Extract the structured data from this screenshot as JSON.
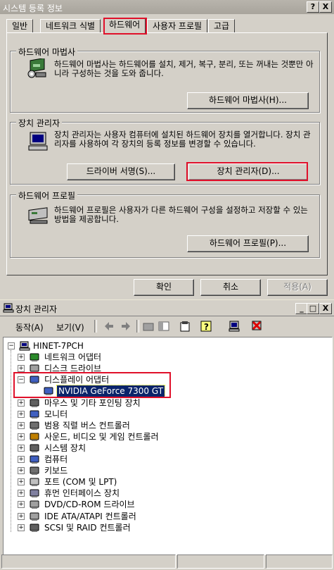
{
  "sysdlg": {
    "title": "시스템 등록 정보",
    "help_btn": "?",
    "close_btn": "X",
    "tabs": [
      "일반",
      "네트워크 식별",
      "하드웨어",
      "사용자 프로필",
      "고급"
    ],
    "groups": {
      "wizard": {
        "label": "하드웨어 마법사",
        "text": "하드웨어 마법사는 하드웨어를 설치, 제거, 복구, 분리, 또는 꺼내는 것뿐만 아니라 구성하는 것을 도와 줍니다.",
        "button": "하드웨어 마법사(H)..."
      },
      "devmgr": {
        "label": "장치 관리자",
        "text": "장치 관리자는 사용자 컴퓨터에 설치된 하드웨어 장치를 열거합니다. 장치 관리자를 사용하여 각 장치의 등록 정보를 변경할 수 있습니다.",
        "btn_sign": "드라이버 서명(S)...",
        "btn_devmgr": "장치 관리자(D)..."
      },
      "profile": {
        "label": "하드웨어 프로필",
        "text": "하드웨어 프로필은 사용자가 다른 하드웨어 구성을 설정하고 저장할 수 있는 방법을 제공합니다.",
        "button": "하드웨어 프로필(P)..."
      }
    },
    "buttons": {
      "ok": "확인",
      "cancel": "취소",
      "apply": "적용(A)"
    }
  },
  "devmgr": {
    "title": "장치 관리자",
    "min": "_",
    "max": "□",
    "close": "X",
    "menu": [
      "동작(A)",
      "보기(V)"
    ],
    "tree": {
      "root": "HINET-7PCH",
      "items": [
        "네트워크 어댑터",
        "디스크 드라이브",
        "디스플레이 어댑터",
        "NVIDIA GeForce 7300 GT",
        "마우스 및 기타 포인팅 장치",
        "모니터",
        "범용 직렬 버스 컨트롤러",
        "사운드, 비디오 및 게임 컨트롤러",
        "시스템 장치",
        "컴퓨터",
        "키보드",
        "포트 (COM 및 LPT)",
        "휴먼 인터페이스 장치",
        "DVD/CD-ROM 드라이브",
        "IDE ATA/ATAPI 컨트롤러",
        "SCSI 및 RAID 컨트롤러"
      ]
    }
  },
  "colors": {
    "highlight": "#e0102a",
    "selection": "#0a246a",
    "dialog_bg": "#d4d0c8"
  }
}
